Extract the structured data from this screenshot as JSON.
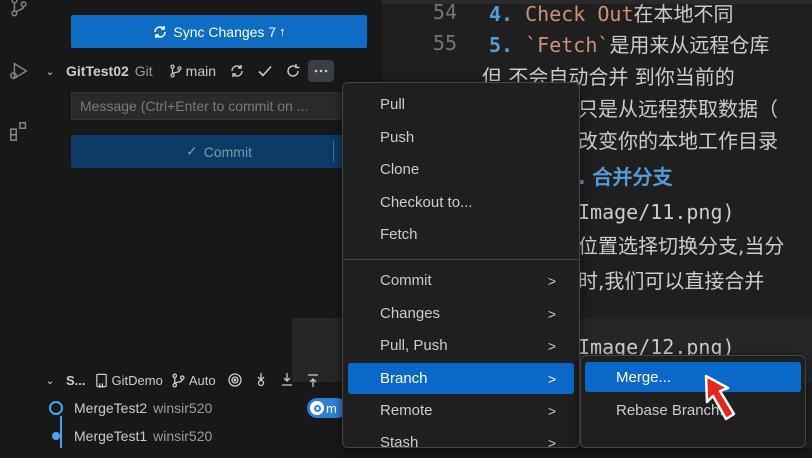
{
  "sidebar": {
    "sync_button": {
      "label": "Sync Changes 7",
      "arrow": "↑"
    },
    "repo": {
      "name": "GitTest02",
      "type": "Git",
      "branch": "main",
      "message_placeholder": "Message (Ctrl+Enter to commit on ...",
      "commit_label": "Commit"
    },
    "graph": {
      "title": "S...",
      "repo": "GitDemo",
      "branch_mode": "Auto",
      "commits": [
        {
          "message": "MergeTest2",
          "author": "winsir520"
        },
        {
          "message": "MergeTest1",
          "author": "winsir520"
        }
      ],
      "ref_badge": "m"
    }
  },
  "editor": {
    "lines": [
      {
        "no": "54",
        "num": "4.",
        "code": "Check Out",
        "rest": "在本地不同"
      },
      {
        "no": "55",
        "num": "5.",
        "code": "`Fetch`",
        "rest": "是用来从远程仓库"
      },
      {
        "no": "",
        "text": "但 不会自动合并 到你当前的"
      },
      {
        "no": "",
        "text": "只是从远程获取数据（"
      },
      {
        "no": "",
        "text": "改变你的本地工作目录"
      },
      {
        "no": "",
        "heading": ". 合并分支"
      },
      {
        "no": "",
        "text": "Image/11.png)"
      },
      {
        "no": "",
        "text": "位置选择切换分支,当分"
      },
      {
        "no": "",
        "text": "时,我们可以直接合并"
      },
      {
        "no": "",
        "text": ""
      },
      {
        "no": "",
        "text": "Image/12.png)"
      }
    ]
  },
  "menu": {
    "items": [
      {
        "label": "Pull",
        "submenu": false
      },
      {
        "label": "Push",
        "submenu": false
      },
      {
        "label": "Clone",
        "submenu": false
      },
      {
        "label": "Checkout to...",
        "submenu": false
      },
      {
        "label": "Fetch",
        "submenu": false
      },
      {
        "label": "Commit",
        "submenu": true
      },
      {
        "label": "Changes",
        "submenu": true
      },
      {
        "label": "Pull, Push",
        "submenu": true
      },
      {
        "label": "Branch",
        "submenu": true,
        "active": true
      },
      {
        "label": "Remote",
        "submenu": true
      },
      {
        "label": "Stash",
        "submenu": true
      }
    ],
    "submenu_arrow": ">",
    "branch_submenu": [
      {
        "label": "Merge...",
        "active": true
      },
      {
        "label": "Rebase Branch..."
      }
    ]
  },
  "colors": {
    "accent": "#0a68c8",
    "sync_button": "#0e6cc4",
    "cursor": "#e8251c"
  }
}
